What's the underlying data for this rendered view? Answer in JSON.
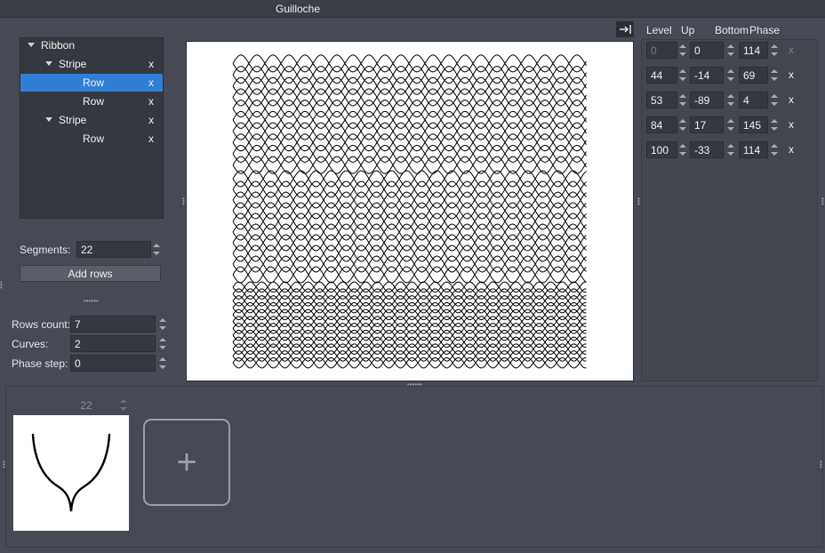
{
  "window": {
    "title": "Guilloche"
  },
  "tree": {
    "items": [
      {
        "label": "Ribbon",
        "depth": 0,
        "expanded": true,
        "selected": false,
        "removable": false
      },
      {
        "label": "Stripe",
        "depth": 1,
        "expanded": true,
        "selected": false,
        "removable": true
      },
      {
        "label": "Row",
        "depth": 2,
        "expanded": false,
        "selected": true,
        "removable": true
      },
      {
        "label": "Row",
        "depth": 2,
        "expanded": false,
        "selected": false,
        "removable": true
      },
      {
        "label": "Stripe",
        "depth": 1,
        "expanded": true,
        "selected": false,
        "removable": true
      },
      {
        "label": "Row",
        "depth": 2,
        "expanded": false,
        "selected": false,
        "removable": true
      }
    ],
    "remove_label": "x"
  },
  "segments": {
    "label": "Segments:",
    "value": "22"
  },
  "add_rows": {
    "label": "Add rows"
  },
  "row_settings": {
    "rows_count": {
      "label": "Rows count:",
      "value": "7"
    },
    "curves": {
      "label": "Curves:",
      "value": "2"
    },
    "phase_step": {
      "label": "Phase step:",
      "value": "0"
    }
  },
  "levels": {
    "headers": {
      "level": "Level",
      "up": "Up",
      "bottom": "Bottom",
      "phase": "Phase"
    },
    "rows": [
      {
        "level": "0",
        "up": "0",
        "phase": "114",
        "disabled": true
      },
      {
        "level": "44",
        "up": "-14",
        "phase": "69",
        "disabled": false
      },
      {
        "level": "53",
        "up": "-89",
        "phase": "4",
        "disabled": false
      },
      {
        "level": "84",
        "up": "17",
        "phase": "145",
        "disabled": false
      },
      {
        "level": "100",
        "up": "-33",
        "phase": "114",
        "disabled": false
      }
    ],
    "remove_label": "x"
  },
  "curve_editor": {
    "segments_value": "22",
    "add_label": "+"
  },
  "colors": {
    "selection": "#2f7fd8",
    "panel": "#474955",
    "field": "#363840"
  }
}
